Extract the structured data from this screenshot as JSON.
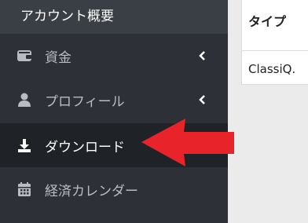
{
  "sidebar": {
    "title": "アカウント概要",
    "items": [
      {
        "label": "資金",
        "icon": "wallet-icon",
        "has_submenu": true
      },
      {
        "label": "プロフィール",
        "icon": "user-icon",
        "has_submenu": true
      },
      {
        "label": "ダウンロード",
        "icon": "download-icon",
        "has_submenu": false,
        "active": true
      },
      {
        "label": "経済カレンダー",
        "icon": "calendar-icon",
        "has_submenu": false
      }
    ]
  },
  "table": {
    "header": "タイプ",
    "cell": "ClassiQ."
  },
  "annotation": {
    "icon": "red-arrow-icon",
    "color": "#e8232a"
  }
}
